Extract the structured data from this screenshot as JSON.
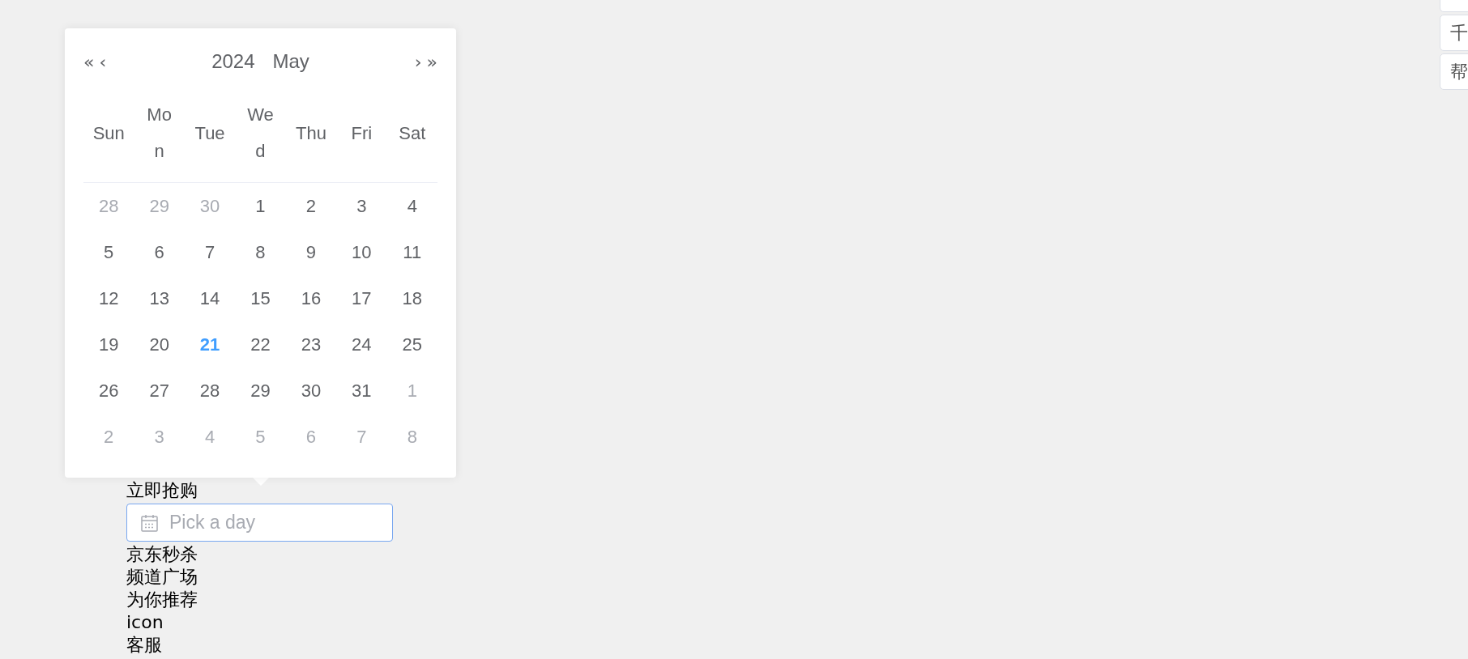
{
  "datepicker": {
    "nav_prev_year": "«",
    "nav_prev_month": "‹",
    "year": "2024",
    "month": "May",
    "nav_next_month": "›",
    "nav_next_year": "»",
    "weekdays": [
      "Sun",
      "Mon",
      "Tue",
      "Wed",
      "Thu",
      "Fri",
      "Sat"
    ],
    "weeks": [
      [
        {
          "label": "28",
          "in_month": false,
          "today": false
        },
        {
          "label": "29",
          "in_month": false,
          "today": false
        },
        {
          "label": "30",
          "in_month": false,
          "today": false
        },
        {
          "label": "1",
          "in_month": true,
          "today": false
        },
        {
          "label": "2",
          "in_month": true,
          "today": false
        },
        {
          "label": "3",
          "in_month": true,
          "today": false
        },
        {
          "label": "4",
          "in_month": true,
          "today": false
        }
      ],
      [
        {
          "label": "5",
          "in_month": true,
          "today": false
        },
        {
          "label": "6",
          "in_month": true,
          "today": false
        },
        {
          "label": "7",
          "in_month": true,
          "today": false
        },
        {
          "label": "8",
          "in_month": true,
          "today": false
        },
        {
          "label": "9",
          "in_month": true,
          "today": false
        },
        {
          "label": "10",
          "in_month": true,
          "today": false
        },
        {
          "label": "11",
          "in_month": true,
          "today": false
        }
      ],
      [
        {
          "label": "12",
          "in_month": true,
          "today": false
        },
        {
          "label": "13",
          "in_month": true,
          "today": false
        },
        {
          "label": "14",
          "in_month": true,
          "today": false
        },
        {
          "label": "15",
          "in_month": true,
          "today": false
        },
        {
          "label": "16",
          "in_month": true,
          "today": false
        },
        {
          "label": "17",
          "in_month": true,
          "today": false
        },
        {
          "label": "18",
          "in_month": true,
          "today": false
        }
      ],
      [
        {
          "label": "19",
          "in_month": true,
          "today": false
        },
        {
          "label": "20",
          "in_month": true,
          "today": false
        },
        {
          "label": "21",
          "in_month": true,
          "today": true
        },
        {
          "label": "22",
          "in_month": true,
          "today": false
        },
        {
          "label": "23",
          "in_month": true,
          "today": false
        },
        {
          "label": "24",
          "in_month": true,
          "today": false
        },
        {
          "label": "25",
          "in_month": true,
          "today": false
        }
      ],
      [
        {
          "label": "26",
          "in_month": true,
          "today": false
        },
        {
          "label": "27",
          "in_month": true,
          "today": false
        },
        {
          "label": "28",
          "in_month": true,
          "today": false
        },
        {
          "label": "29",
          "in_month": true,
          "today": false
        },
        {
          "label": "30",
          "in_month": true,
          "today": false
        },
        {
          "label": "31",
          "in_month": true,
          "today": false
        },
        {
          "label": "1",
          "in_month": false,
          "today": false
        }
      ],
      [
        {
          "label": "2",
          "in_month": false,
          "today": false
        },
        {
          "label": "3",
          "in_month": false,
          "today": false
        },
        {
          "label": "4",
          "in_month": false,
          "today": false
        },
        {
          "label": "5",
          "in_month": false,
          "today": false
        },
        {
          "label": "6",
          "in_month": false,
          "today": false
        },
        {
          "label": "7",
          "in_month": false,
          "today": false
        },
        {
          "label": "8",
          "in_month": false,
          "today": false
        }
      ]
    ]
  },
  "items_before": [
    "立即抢购"
  ],
  "date_input": {
    "placeholder": "Pick a day"
  },
  "items_after": [
    "京东秒杀",
    "频道广场",
    "为你推荐",
    "icon",
    "客服"
  ],
  "side_buttons": [
    {
      "label": "千"
    },
    {
      "label": "帮"
    }
  ]
}
